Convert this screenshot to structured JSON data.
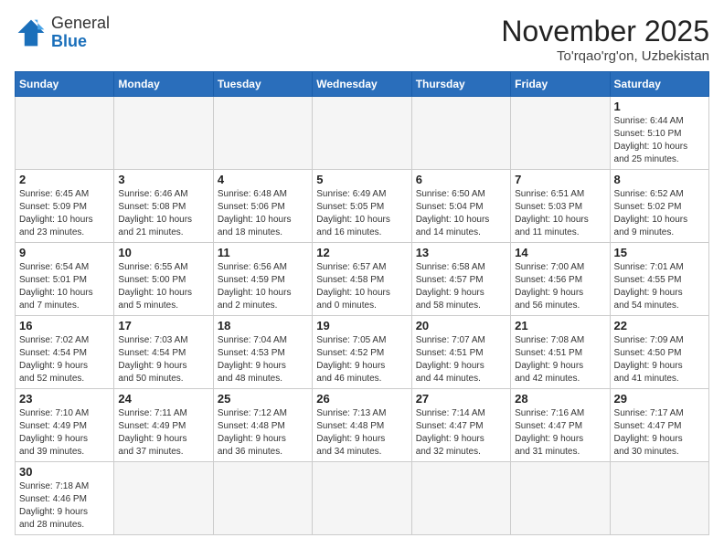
{
  "logo": {
    "line1": "General",
    "line2": "Blue"
  },
  "title": "November 2025",
  "location": "To'rqao'rg'on, Uzbekistan",
  "weekdays": [
    "Sunday",
    "Monday",
    "Tuesday",
    "Wednesday",
    "Thursday",
    "Friday",
    "Saturday"
  ],
  "weeks": [
    [
      {
        "day": "",
        "info": ""
      },
      {
        "day": "",
        "info": ""
      },
      {
        "day": "",
        "info": ""
      },
      {
        "day": "",
        "info": ""
      },
      {
        "day": "",
        "info": ""
      },
      {
        "day": "",
        "info": ""
      },
      {
        "day": "1",
        "info": "Sunrise: 6:44 AM\nSunset: 5:10 PM\nDaylight: 10 hours\nand 25 minutes."
      }
    ],
    [
      {
        "day": "2",
        "info": "Sunrise: 6:45 AM\nSunset: 5:09 PM\nDaylight: 10 hours\nand 23 minutes."
      },
      {
        "day": "3",
        "info": "Sunrise: 6:46 AM\nSunset: 5:08 PM\nDaylight: 10 hours\nand 21 minutes."
      },
      {
        "day": "4",
        "info": "Sunrise: 6:48 AM\nSunset: 5:06 PM\nDaylight: 10 hours\nand 18 minutes."
      },
      {
        "day": "5",
        "info": "Sunrise: 6:49 AM\nSunset: 5:05 PM\nDaylight: 10 hours\nand 16 minutes."
      },
      {
        "day": "6",
        "info": "Sunrise: 6:50 AM\nSunset: 5:04 PM\nDaylight: 10 hours\nand 14 minutes."
      },
      {
        "day": "7",
        "info": "Sunrise: 6:51 AM\nSunset: 5:03 PM\nDaylight: 10 hours\nand 11 minutes."
      },
      {
        "day": "8",
        "info": "Sunrise: 6:52 AM\nSunset: 5:02 PM\nDaylight: 10 hours\nand 9 minutes."
      }
    ],
    [
      {
        "day": "9",
        "info": "Sunrise: 6:54 AM\nSunset: 5:01 PM\nDaylight: 10 hours\nand 7 minutes."
      },
      {
        "day": "10",
        "info": "Sunrise: 6:55 AM\nSunset: 5:00 PM\nDaylight: 10 hours\nand 5 minutes."
      },
      {
        "day": "11",
        "info": "Sunrise: 6:56 AM\nSunset: 4:59 PM\nDaylight: 10 hours\nand 2 minutes."
      },
      {
        "day": "12",
        "info": "Sunrise: 6:57 AM\nSunset: 4:58 PM\nDaylight: 10 hours\nand 0 minutes."
      },
      {
        "day": "13",
        "info": "Sunrise: 6:58 AM\nSunset: 4:57 PM\nDaylight: 9 hours\nand 58 minutes."
      },
      {
        "day": "14",
        "info": "Sunrise: 7:00 AM\nSunset: 4:56 PM\nDaylight: 9 hours\nand 56 minutes."
      },
      {
        "day": "15",
        "info": "Sunrise: 7:01 AM\nSunset: 4:55 PM\nDaylight: 9 hours\nand 54 minutes."
      }
    ],
    [
      {
        "day": "16",
        "info": "Sunrise: 7:02 AM\nSunset: 4:54 PM\nDaylight: 9 hours\nand 52 minutes."
      },
      {
        "day": "17",
        "info": "Sunrise: 7:03 AM\nSunset: 4:54 PM\nDaylight: 9 hours\nand 50 minutes."
      },
      {
        "day": "18",
        "info": "Sunrise: 7:04 AM\nSunset: 4:53 PM\nDaylight: 9 hours\nand 48 minutes."
      },
      {
        "day": "19",
        "info": "Sunrise: 7:05 AM\nSunset: 4:52 PM\nDaylight: 9 hours\nand 46 minutes."
      },
      {
        "day": "20",
        "info": "Sunrise: 7:07 AM\nSunset: 4:51 PM\nDaylight: 9 hours\nand 44 minutes."
      },
      {
        "day": "21",
        "info": "Sunrise: 7:08 AM\nSunset: 4:51 PM\nDaylight: 9 hours\nand 42 minutes."
      },
      {
        "day": "22",
        "info": "Sunrise: 7:09 AM\nSunset: 4:50 PM\nDaylight: 9 hours\nand 41 minutes."
      }
    ],
    [
      {
        "day": "23",
        "info": "Sunrise: 7:10 AM\nSunset: 4:49 PM\nDaylight: 9 hours\nand 39 minutes."
      },
      {
        "day": "24",
        "info": "Sunrise: 7:11 AM\nSunset: 4:49 PM\nDaylight: 9 hours\nand 37 minutes."
      },
      {
        "day": "25",
        "info": "Sunrise: 7:12 AM\nSunset: 4:48 PM\nDaylight: 9 hours\nand 36 minutes."
      },
      {
        "day": "26",
        "info": "Sunrise: 7:13 AM\nSunset: 4:48 PM\nDaylight: 9 hours\nand 34 minutes."
      },
      {
        "day": "27",
        "info": "Sunrise: 7:14 AM\nSunset: 4:47 PM\nDaylight: 9 hours\nand 32 minutes."
      },
      {
        "day": "28",
        "info": "Sunrise: 7:16 AM\nSunset: 4:47 PM\nDaylight: 9 hours\nand 31 minutes."
      },
      {
        "day": "29",
        "info": "Sunrise: 7:17 AM\nSunset: 4:47 PM\nDaylight: 9 hours\nand 30 minutes."
      }
    ],
    [
      {
        "day": "30",
        "info": "Sunrise: 7:18 AM\nSunset: 4:46 PM\nDaylight: 9 hours\nand 28 minutes."
      },
      {
        "day": "",
        "info": ""
      },
      {
        "day": "",
        "info": ""
      },
      {
        "day": "",
        "info": ""
      },
      {
        "day": "",
        "info": ""
      },
      {
        "day": "",
        "info": ""
      },
      {
        "day": "",
        "info": ""
      }
    ]
  ]
}
